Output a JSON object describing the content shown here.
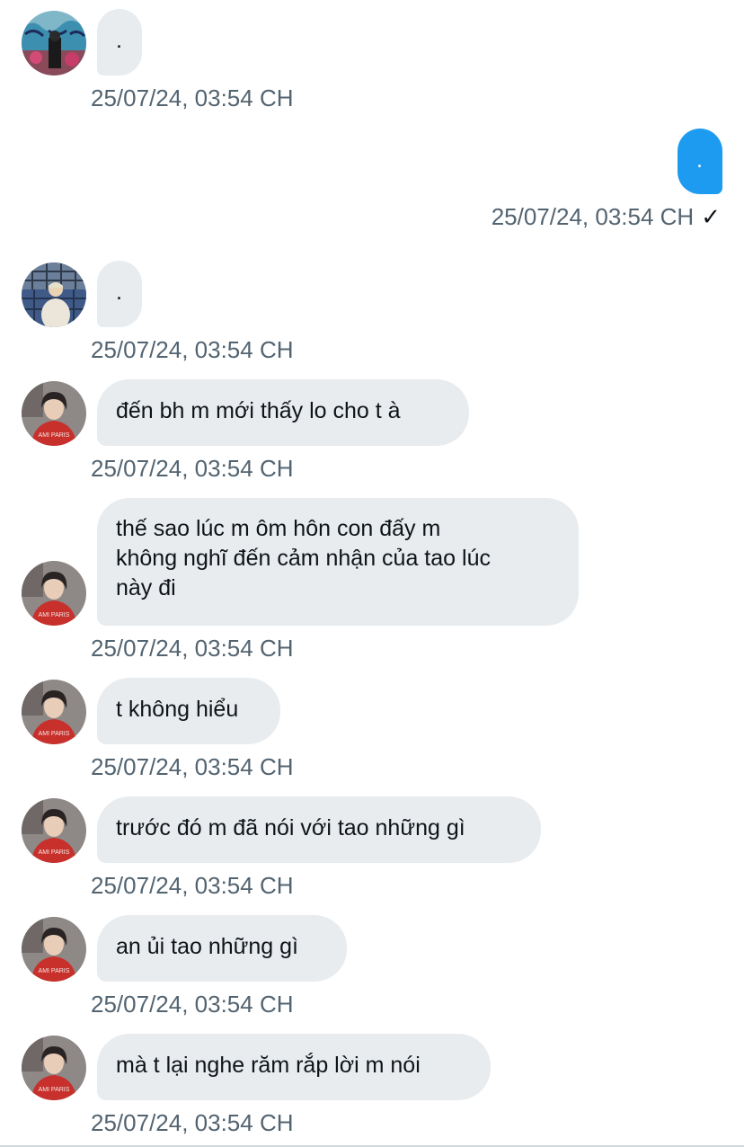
{
  "messages": [
    {
      "sender": "other",
      "avatar": "avatar-graffiti",
      "text": ".",
      "time": "25/07/24, 03:54 CH"
    },
    {
      "sender": "me",
      "text": ".",
      "time": "25/07/24, 03:54 CH",
      "read_icon": "checkmark-icon",
      "read_glyph": "✓"
    },
    {
      "sender": "other",
      "avatar": "avatar-window",
      "text": ".",
      "time": "25/07/24, 03:54 CH"
    },
    {
      "sender": "other",
      "avatar": "avatar-red-hoodie",
      "text": "đến bh m mới thấy lo cho t à",
      "time": "25/07/24, 03:54 CH"
    },
    {
      "sender": "other",
      "avatar": "avatar-red-hoodie",
      "text": "thế sao lúc m ôm hôn con đấy m\nkhông nghĩ đến cảm nhận của tao lúc\nnày đi",
      "time": "25/07/24, 03:54 CH"
    },
    {
      "sender": "other",
      "avatar": "avatar-red-hoodie",
      "text": "t không hiểu",
      "time": "25/07/24, 03:54 CH"
    },
    {
      "sender": "other",
      "avatar": "avatar-red-hoodie",
      "text": "trước đó m đã nói với tao những gì",
      "time": "25/07/24, 03:54 CH"
    },
    {
      "sender": "other",
      "avatar": "avatar-red-hoodie",
      "text": "an ủi tao những gì",
      "time": "25/07/24, 03:54 CH"
    },
    {
      "sender": "other",
      "avatar": "avatar-red-hoodie",
      "text": "mà t lại nghe răm rắp lời m nói",
      "time": "25/07/24, 03:54 CH"
    }
  ],
  "colors": {
    "bubble_other": "#e8ecef",
    "bubble_mine": "#1d9bf0",
    "timestamp": "#536471",
    "text": "#0f1419"
  }
}
